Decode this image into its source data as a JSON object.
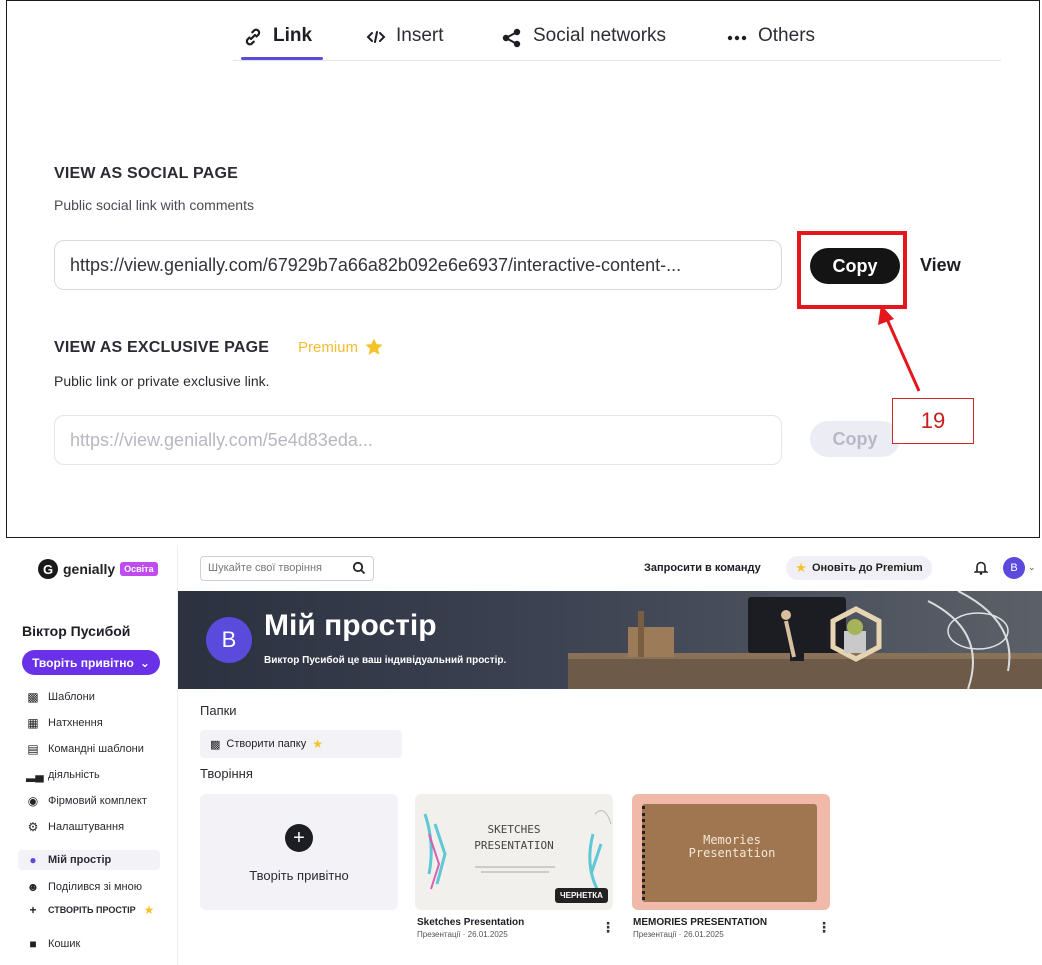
{
  "share": {
    "tabs": [
      {
        "label": "Link",
        "icon": "link-icon"
      },
      {
        "label": "Insert",
        "icon": "code-icon"
      },
      {
        "label": "Social networks",
        "icon": "share-icon"
      },
      {
        "label": "Others",
        "icon": "more-icon"
      }
    ],
    "social": {
      "title": "VIEW AS SOCIAL PAGE",
      "subtitle": "Public social link with comments",
      "url": "https://view.genially.com/67929b7a66a82b092e6e6937/interactive-content-...",
      "copy_label": "Copy",
      "view_label": "View"
    },
    "exclusive": {
      "title": "VIEW AS EXCLUSIVE PAGE",
      "premium_label": "Premium",
      "subtitle": "Public link or private exclusive link.",
      "url": "https://view.genially.com/5e4d83eda...",
      "copy_label": "Copy"
    },
    "annotation_number": "19"
  },
  "dashboard": {
    "logo_text": "genially",
    "edu_badge": "Освіта",
    "user_name": "Віктор Пусибой",
    "create_button": "Творіть привітно",
    "nav": [
      {
        "label": "Шаблони",
        "icon": "grid-icon"
      },
      {
        "label": "Натхнення",
        "icon": "inspiration-icon"
      },
      {
        "label": "Командні шаблони",
        "icon": "team-templates-icon"
      },
      {
        "label": "діяльність",
        "icon": "activity-icon"
      },
      {
        "label": "Фірмовий комплект",
        "icon": "brand-kit-icon"
      },
      {
        "label": "Налаштування",
        "icon": "gear-icon"
      },
      {
        "label": "Мій простір",
        "icon": "my-space-icon"
      },
      {
        "label": "Поділився зі мною",
        "icon": "shared-icon"
      },
      {
        "label": "СТВОРІТЬ ПРОСТІР",
        "icon": "plus-icon"
      },
      {
        "label": "Кошик",
        "icon": "trash-icon"
      }
    ],
    "search_placeholder": "Шукайте свої творіння",
    "invite_label": "Запросити в команду",
    "upgrade_label": "Оновіть до Premium",
    "avatar_letter": "B",
    "banner": {
      "title": "Мій простір",
      "subtitle": "Виктор Пусибой це ваш індивідуальний простір."
    },
    "folders_heading": "Папки",
    "create_folder": "Створити папку",
    "creations_heading": "Творіння",
    "new_creation_label": "Творіть привітно",
    "cards": [
      {
        "thumb_text": "SKETCHES PRESENTATION",
        "badge": "ЧЕРНЕТКА",
        "title": "Sketches Presentation",
        "meta": "Презентації · 26.01.2025"
      },
      {
        "thumb_text": "Memories Presentation",
        "title": "MEMORIES PRESENTATION",
        "meta": "Презентації · 26.01.2025"
      }
    ]
  }
}
